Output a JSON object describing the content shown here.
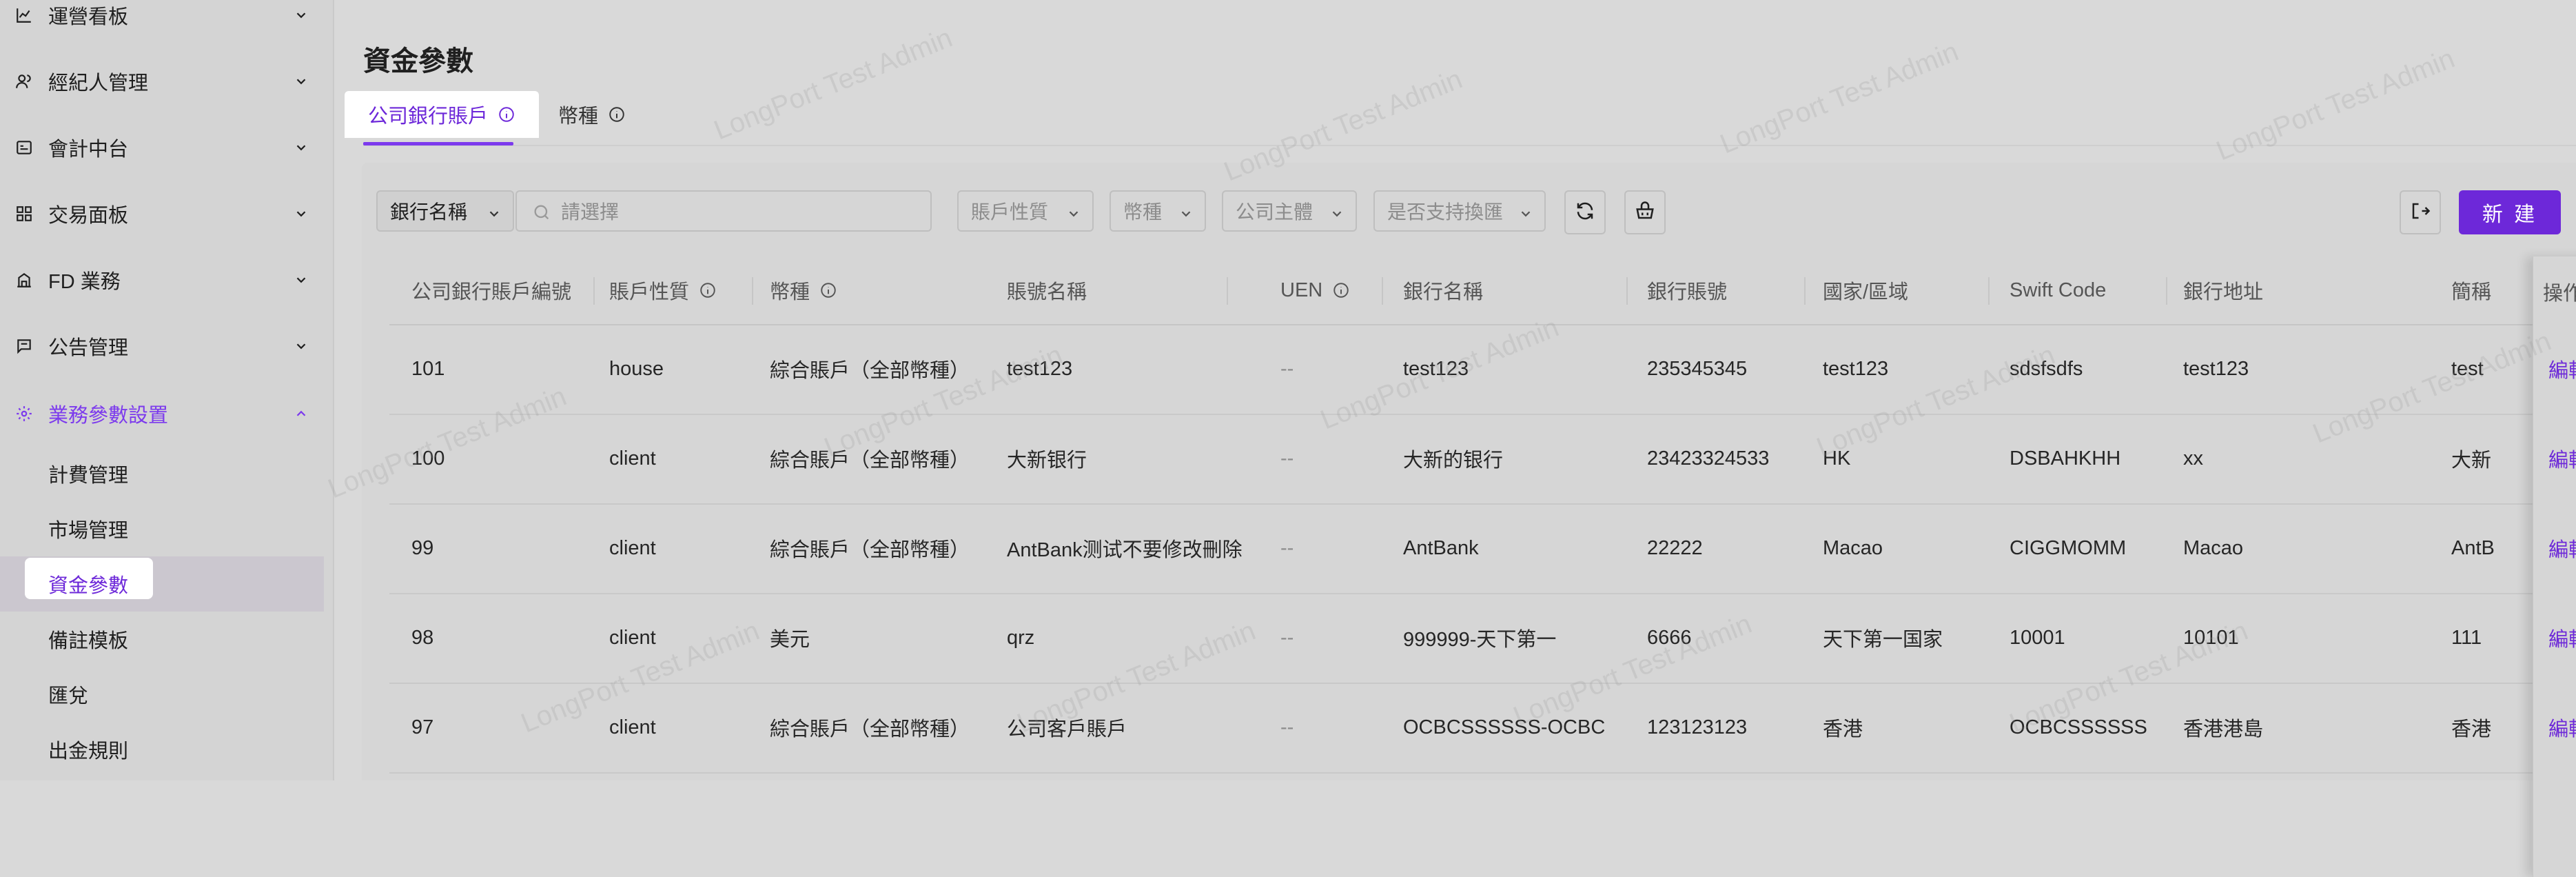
{
  "sidebar": {
    "items": [
      {
        "label": "運營看板",
        "icon": "chart-line-icon"
      },
      {
        "label": "經紀人管理",
        "icon": "user-group-icon"
      },
      {
        "label": "會計中台",
        "icon": "ledger-icon"
      },
      {
        "label": "交易面板",
        "icon": "dashboard-grid-icon"
      },
      {
        "label": "FD 業務",
        "icon": "bank-icon"
      },
      {
        "label": "公告管理",
        "icon": "message-icon"
      },
      {
        "label": "業務參數設置",
        "icon": "gear-icon"
      }
    ],
    "sub_items": [
      {
        "label": "計費管理"
      },
      {
        "label": "市場管理"
      },
      {
        "label": "資金參數"
      },
      {
        "label": "備註模板"
      },
      {
        "label": "匯兌"
      },
      {
        "label": "出金規則"
      }
    ]
  },
  "page": {
    "title": "資金參數",
    "tabs": [
      {
        "label": "公司銀行賬戶"
      },
      {
        "label": "幣種"
      }
    ]
  },
  "filters": {
    "field_select": "銀行名稱",
    "search_placeholder": "請選擇",
    "account_type": "賬戶性質",
    "currency": "幣種",
    "entity": "公司主體",
    "exchange_support": "是否支持換匯",
    "new_button": "新 建"
  },
  "watermark": "LongPort Test Admin",
  "table": {
    "columns": [
      "公司銀行賬戶編號",
      "賬戶性質",
      "幣種",
      "賬號名稱",
      "UEN",
      "銀行名稱",
      "銀行賬號",
      "國家/區域",
      "Swift Code",
      "銀行地址",
      "簡稱"
    ],
    "ops_header": "操作",
    "edit_label": "編輯",
    "rows": [
      {
        "id": "101",
        "type": "house",
        "currency": "綜合賬戶（全部幣種）",
        "account_name": "test123",
        "uen": "--",
        "bank": "test123",
        "bank_no": "235345345",
        "region": "test123",
        "swift": "sdsfsdfs",
        "address": "test123",
        "short": "test"
      },
      {
        "id": "100",
        "type": "client",
        "currency": "綜合賬戶（全部幣種）",
        "account_name": "大新银行",
        "uen": "--",
        "bank": "大新的银行",
        "bank_no": "23423324533",
        "region": "HK",
        "swift": "DSBAHKHH",
        "address": "xx",
        "short": "大新"
      },
      {
        "id": "99",
        "type": "client",
        "currency": "綜合賬戶（全部幣種）",
        "account_name": "AntBank测试不要修改刪除",
        "uen": "--",
        "bank": "AntBank",
        "bank_no": "22222",
        "region": "Macao",
        "swift": "CIGGMOMM",
        "address": "Macao",
        "short": "AntB"
      },
      {
        "id": "98",
        "type": "client",
        "currency": "美元",
        "account_name": "qrz",
        "uen": "--",
        "bank": "999999-天下第一",
        "bank_no": "6666",
        "region": "天下第一国家",
        "swift": "10001",
        "address": "10101",
        "short": "111"
      },
      {
        "id": "97",
        "type": "client",
        "currency": "綜合賬戶（全部幣種）",
        "account_name": "公司客戶賬戶",
        "uen": "--",
        "bank": "OCBCSSSSSS-OCBC",
        "bank_no": "123123123",
        "region": "香港",
        "swift": "OCBCSSSSSS",
        "address": "香港港島",
        "short": "香港"
      }
    ]
  }
}
